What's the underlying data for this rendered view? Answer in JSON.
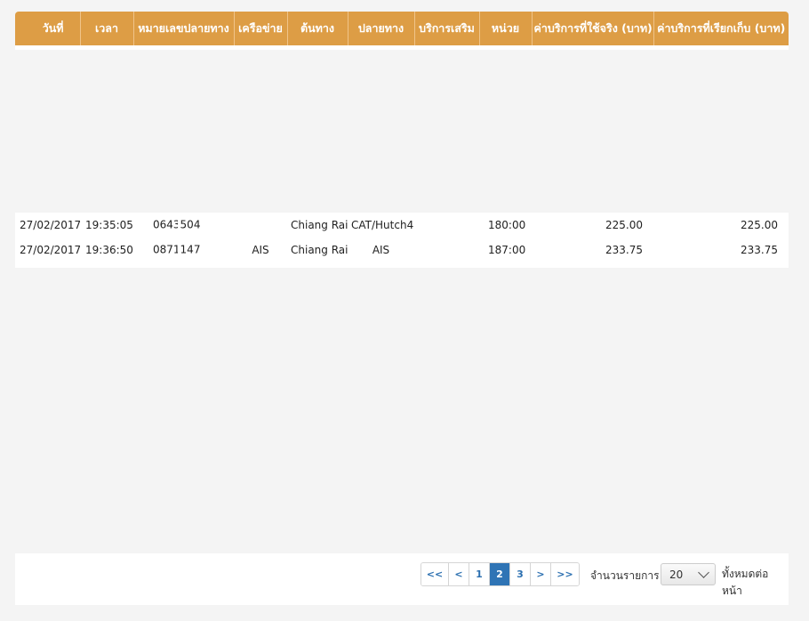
{
  "table": {
    "headers": [
      "วันที่",
      "เวลา",
      "หมายเลขปลายทาง",
      "เครือข่าย",
      "ต้นทาง",
      "ปลายทาง",
      "บริการเสริม",
      "หน่วย",
      "ค่าบริการที่ใช้จริง (บาท)",
      "ค่าบริการที่เรียกเก็บ (บาท)"
    ],
    "rows": [
      {
        "date": "27/02/2017",
        "time": "19:35:05",
        "number_a": "0643",
        "number_b": "504",
        "network": "",
        "source": "Chiang Rai",
        "destination": "CAT/Hutch4",
        "addon": "",
        "units": "180:00",
        "actual": "225.00",
        "charged": "225.00"
      },
      {
        "date": "27/02/2017",
        "time": "19:36:50",
        "number_a": "0871",
        "number_b": "147",
        "network": "AIS",
        "source": "Chiang Rai",
        "destination": "AIS",
        "addon": "",
        "units": "187:00",
        "actual": "233.75",
        "charged": "233.75"
      }
    ]
  },
  "pagination": {
    "first": "<<",
    "prev": "<",
    "pages": [
      "1",
      "2",
      "3"
    ],
    "current": "2",
    "next": ">",
    "last": ">>",
    "per_page_label": "จำนวนรายการ",
    "per_page_value": "20",
    "per_page_suffix": "ทั้งหมดต่อหน้า"
  },
  "colors": {
    "header_bg": "#dd9d45",
    "active_page": "#2f74b5"
  }
}
